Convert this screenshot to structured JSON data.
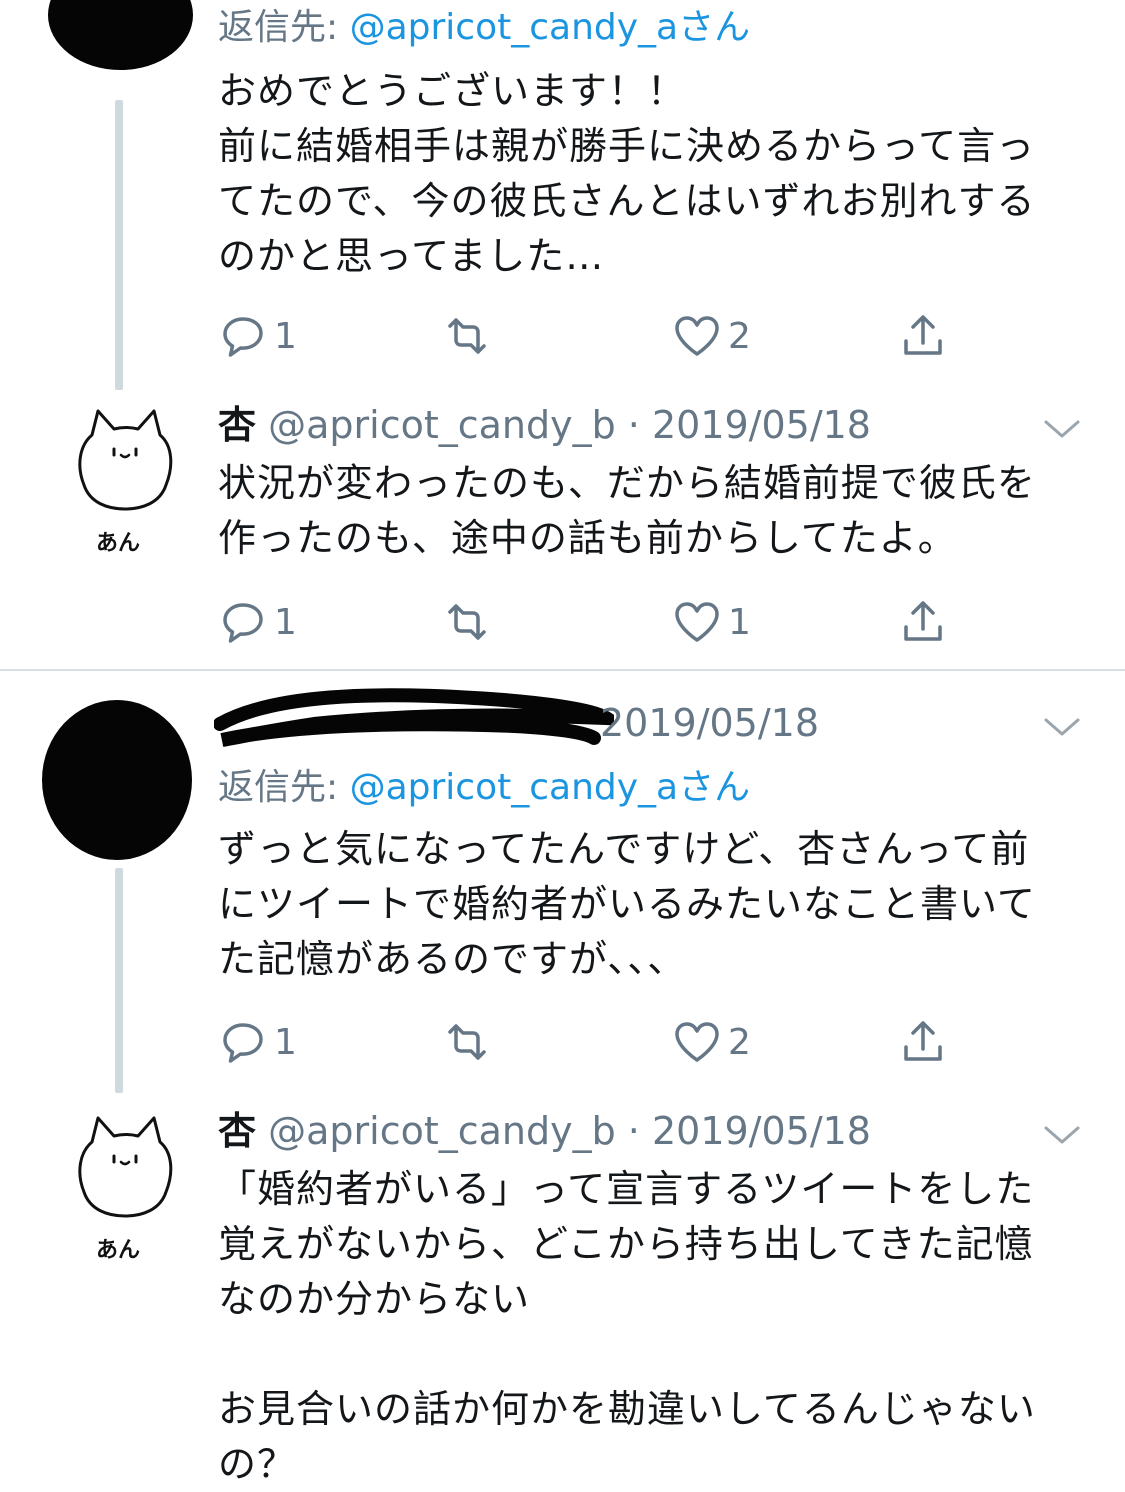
{
  "colors": {
    "link": "#1b95e0",
    "secondary": "#657786",
    "text": "#14171a",
    "thread_line": "#cfd9de"
  },
  "tweets": [
    {
      "reply_to_prefix": "返信先: ",
      "reply_to_handle": "@apricot_candy_aさん",
      "body": "おめでとうございます！！\n前に結婚相手は親が勝手に決めるからって言ってたので、今の彼氏さんとはいずれお別れするのかと思ってました…",
      "actions": {
        "reply": "1",
        "retweet": "",
        "like": "2"
      }
    },
    {
      "name": "杏",
      "handle_date": "@apricot_candy_b · 2019/05/18",
      "avatar_label": "あん",
      "body": "状況が変わったのも、だから結婚前提で彼氏を作ったのも、途中の話も前からしてたよ。",
      "actions": {
        "reply": "1",
        "retweet": "",
        "like": "1"
      }
    },
    {
      "date": "2019/05/18",
      "reply_to_prefix": "返信先: ",
      "reply_to_handle": "@apricot_candy_aさん",
      "body": "ずっと気になってたんですけど、杏さんって前にツイートで婚約者がいるみたいなこと書いてた記憶があるのですが、、、",
      "actions": {
        "reply": "1",
        "retweet": "",
        "like": "2"
      }
    },
    {
      "name": "杏",
      "handle_date": "@apricot_candy_b · 2019/05/18",
      "avatar_label": "あん",
      "body": "「婚約者がいる」って宣言するツイートをした覚えがないから、どこから持ち出してきた記憶なのか分からない\n\nお見合いの話か何かを勘違いしてるんじゃないの？",
      "actions": {
        "reply": "",
        "retweet": "",
        "like": ""
      }
    }
  ],
  "icons": [
    "reply-icon",
    "retweet-icon",
    "like-icon",
    "share-icon",
    "chevron-down-icon",
    "cat-avatar-icon"
  ]
}
